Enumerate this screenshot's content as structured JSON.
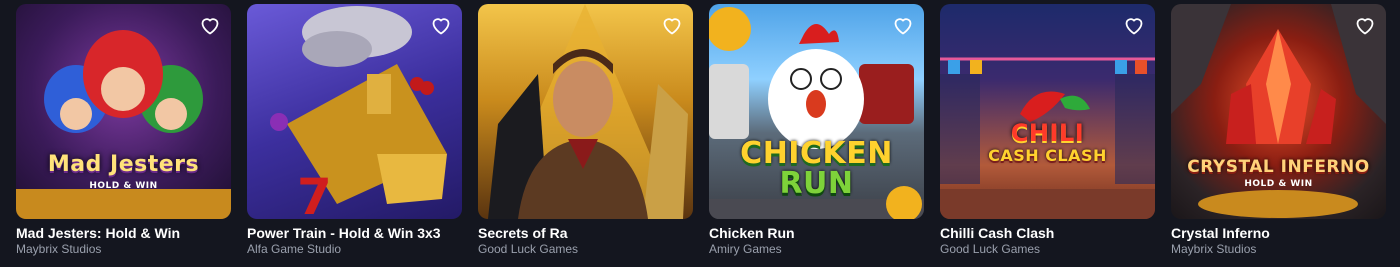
{
  "games": [
    {
      "title": "Mad Jesters: Hold & Win",
      "provider": "Maybrix Studios",
      "logo": "Mad Jesters",
      "logo_sub": "HOLD & WIN",
      "bg": "jesters"
    },
    {
      "title": "Power Train - Hold & Win 3x3",
      "provider": "Alfa Game Studio",
      "bg": "train"
    },
    {
      "title": "Secrets of Ra",
      "provider": "Good Luck Games",
      "bg": "ra"
    },
    {
      "title": "Chicken Run",
      "provider": "Amiry Games",
      "logo": "CHICKEN",
      "logo_sub": "RUN",
      "bg": "chicken"
    },
    {
      "title": "Chilli Cash Clash",
      "provider": "Good Luck Games",
      "logo": "CHILI",
      "logo_sub": "CASH CLASH",
      "bg": "chilli"
    },
    {
      "title": "Crystal Inferno",
      "provider": "Maybrix Studios",
      "logo": "CRYSTAL INFERNO",
      "logo_sub": "HOLD & WIN",
      "bg": "crystal"
    }
  ],
  "colors": {
    "background": "#14161f",
    "title": "#ffffff",
    "provider": "#9aa0ad",
    "heart": "#ffffff"
  },
  "icons": {
    "favorite": "heart-outline-icon"
  }
}
